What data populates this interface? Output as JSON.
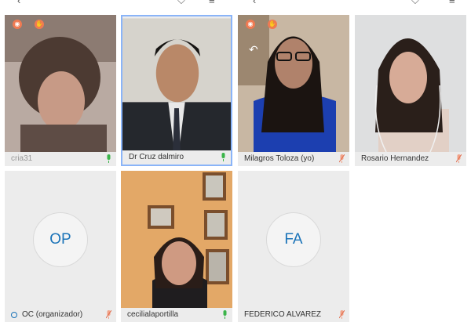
{
  "topbar": {
    "back_icon": "chevron-left-icon",
    "signal_icon": "signal-icon",
    "list_icon": "list-icon"
  },
  "participants": [
    {
      "name": "cria31",
      "mic": "on",
      "kind": "video"
    },
    {
      "name": "Dr Cruz dalmiro",
      "mic": "on",
      "kind": "video",
      "active": true
    },
    {
      "name": "Milagros Toloza (yo)",
      "mic": "off",
      "kind": "video"
    },
    {
      "name": "Rosario Hernandez",
      "mic": "off",
      "kind": "video"
    },
    {
      "name": "OC (organizador)",
      "initials": "OP",
      "mic": "off",
      "kind": "avatar"
    },
    {
      "name": "cecilialaportilla",
      "mic": "on",
      "kind": "video"
    },
    {
      "name": "FEDERICO ALVAREZ",
      "initials": "FA",
      "mic": "off",
      "kind": "avatar"
    }
  ],
  "colors": {
    "mic_on": "#3bb54a",
    "mic_off": "#f2a48a",
    "avatar_text": "#1a73b8",
    "badge": "#f07a52",
    "active_border": "#8ab4f8"
  }
}
